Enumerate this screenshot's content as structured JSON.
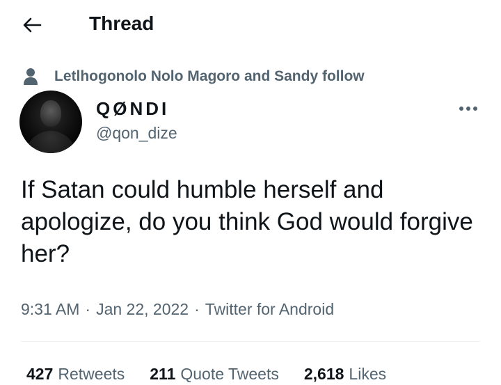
{
  "header": {
    "title": "Thread",
    "back_icon": "arrow-left-icon"
  },
  "social_context": {
    "icon": "person-icon",
    "text": "Letlhogonolo Nolo Magoro and Sandy follow"
  },
  "author": {
    "display_name": "QØNDI",
    "handle": "@qon_dize",
    "avatar": "avatar-photo"
  },
  "more_icon": "more-horizontal-icon",
  "tweet": {
    "text": "If Satan could humble herself and apologize, do you think God would forgive her?"
  },
  "meta": {
    "time": "9:31 AM",
    "separator": "·",
    "date": "Jan 22, 2022",
    "source": "Twitter for Android"
  },
  "stats": [
    {
      "count": "427",
      "label": "Retweets"
    },
    {
      "count": "211",
      "label": "Quote Tweets"
    },
    {
      "count": "2,618",
      "label": "Likes"
    }
  ],
  "colors": {
    "text_primary": "#0f1419",
    "text_secondary": "#536471",
    "divider": "#eff3f4",
    "background": "#ffffff"
  }
}
